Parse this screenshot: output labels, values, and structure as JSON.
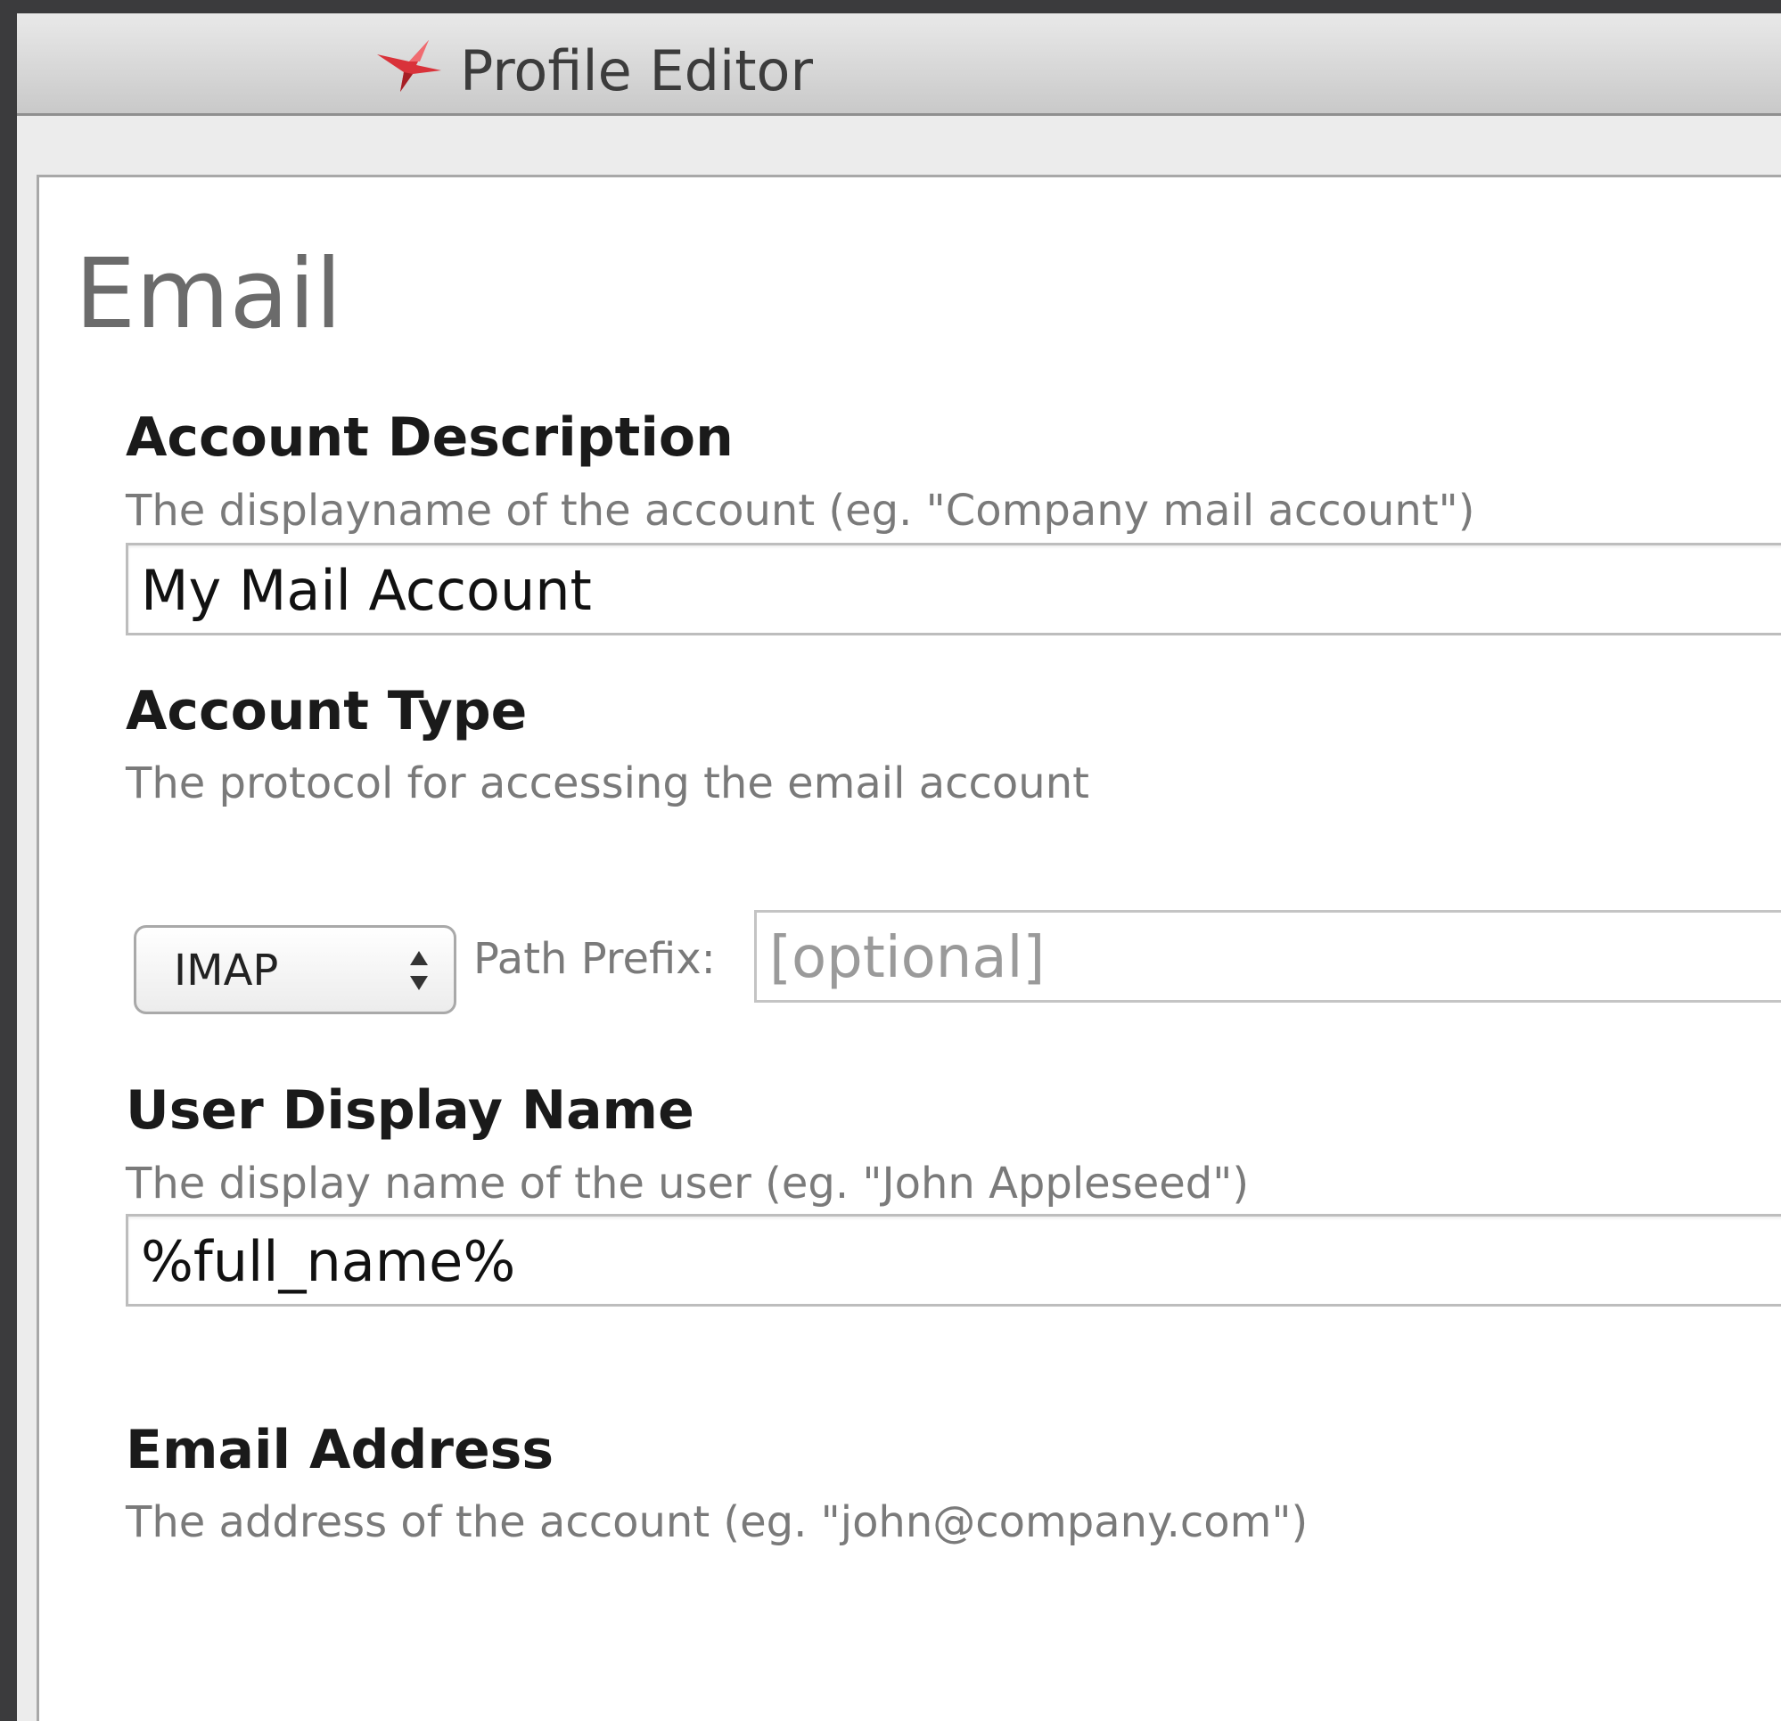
{
  "window": {
    "title": "Profile Editor"
  },
  "page": {
    "title": "Email"
  },
  "sections": {
    "account_description": {
      "heading": "Account Description",
      "description": "The displayname of the account (eg. \"Company mail account\")",
      "value": "My Mail Account"
    },
    "account_type": {
      "heading": "Account Type",
      "description": "The protocol for accessing the email account",
      "selected": "IMAP",
      "path_prefix_label": "Path Prefix:",
      "path_prefix_placeholder": "[optional]"
    },
    "user_display_name": {
      "heading": "User Display Name",
      "description": "The display name of the user (eg. \"John Appleseed\")",
      "value": "%full_name%"
    },
    "email_address": {
      "heading": "Email Address",
      "description": "The address of the account (eg. \"john@company.com\")"
    }
  },
  "icons": {
    "app": "profile-manager-bird-icon",
    "select": "up-down-arrows-icon"
  },
  "colors": {
    "app_icon": "#d9323a",
    "heading": "#1a1a1a",
    "description": "#7a7a7a"
  }
}
